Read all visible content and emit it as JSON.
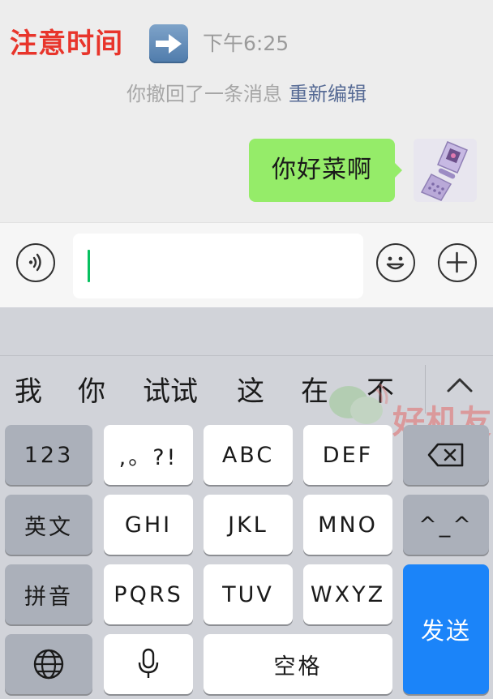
{
  "header": {
    "title": "注意时间",
    "emoji": "right-arrow-emoji",
    "time": "下午6:25"
  },
  "system_notice": {
    "text": "你撤回了一条消息",
    "action": "重新编辑",
    "action_color": "#576b95"
  },
  "message": {
    "text": "你好菜啊",
    "bubble_color": "#95ec69",
    "avatar": "flip-phone-image"
  },
  "input_bar": {
    "voice_icon": "voice-icon",
    "input_value": "",
    "emoji_icon": "smiley-icon",
    "more_icon": "plus-icon",
    "caret_color": "#07c160"
  },
  "keyboard": {
    "candidates": [
      "我",
      "你",
      "试试",
      "这",
      "在",
      "不"
    ],
    "expand_icon": "chevron-up-icon",
    "keys": {
      "numbers": "123",
      "punct": ",。?!",
      "abc": "ABC",
      "def": "DEF",
      "delete_icon": "backspace-icon",
      "english": "英文",
      "ghi": "GHI",
      "jkl": "JKL",
      "mno": "MNO",
      "kaomoji": "^_^",
      "pinyin": "拼音",
      "pqrs": "PQRS",
      "tuv": "TUV",
      "wxyz": "WXYZ",
      "send": "发送",
      "globe_icon": "globe-icon",
      "mic_icon": "microphone-icon",
      "space": "空格"
    },
    "send_color": "#1b84f9"
  },
  "watermark": {
    "text": "好机友"
  }
}
